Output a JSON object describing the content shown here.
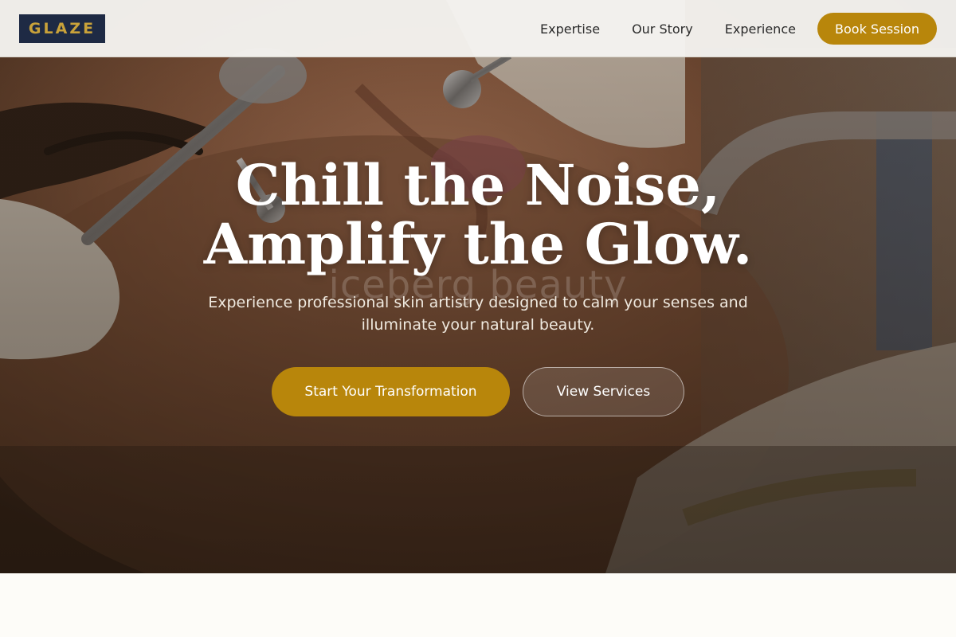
{
  "nav": {
    "logo": "GLAZE",
    "links": [
      "Expertise",
      "Our Story",
      "Experience"
    ],
    "book_label": "Book Session"
  },
  "hero": {
    "headline_line1": "Chill the Noise,",
    "headline_line2": "Amplify the Glow.",
    "watermark": "iceberg beauty",
    "subtext": "Experience professional skin artistry designed to calm your senses and illuminate your natural beauty.",
    "primary_cta": "Start Your Transformation",
    "secondary_cta": "View Services"
  },
  "colors": {
    "accent_gold": "#b8860b",
    "logo_navy": "#1e2a44",
    "logo_text": "#c9a23a",
    "page_background": "#fdfcf8"
  }
}
